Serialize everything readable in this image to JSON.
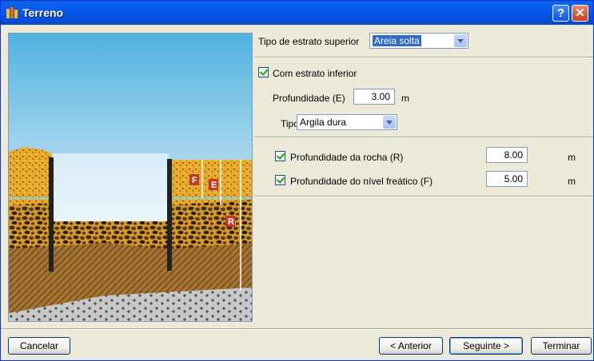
{
  "window": {
    "title": "Terreno"
  },
  "upper_stratum": {
    "label": "Tipo de estrato superior",
    "value": "Areia solta"
  },
  "lower_stratum": {
    "checkbox_label": "Com estrato inferior",
    "depth_label": "Profundidade (E)",
    "depth_value": "3.00",
    "depth_unit": "m",
    "type_label": "Tipo",
    "type_value": "Argila dura"
  },
  "rock_depth": {
    "label": "Profundidade da rocha (R)",
    "value": "8.00",
    "unit": "m"
  },
  "water_table": {
    "label": "Profundidade do nível freático (F)",
    "value": "5.00",
    "unit": "m"
  },
  "picture": {
    "label_f": "F",
    "label_e": "E",
    "label_r": "R"
  },
  "buttons": {
    "cancel": "Cancelar",
    "previous": "< Anterior",
    "next": "Seguinte >",
    "finish": "Terminar"
  }
}
